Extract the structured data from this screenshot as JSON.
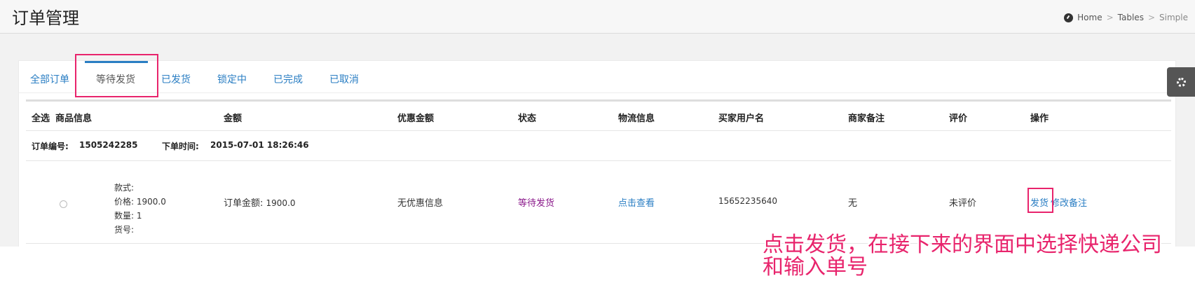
{
  "header": {
    "title": "订单管理"
  },
  "breadcrumb": {
    "items": [
      "Home",
      "Tables",
      "Simple"
    ],
    "separator": ">",
    "icon": "dashboard-icon"
  },
  "tabs": [
    {
      "label": "全部订单",
      "active": false
    },
    {
      "label": "等待发货",
      "active": true
    },
    {
      "label": "已发货",
      "active": false
    },
    {
      "label": "锁定中",
      "active": false
    },
    {
      "label": "已完成",
      "active": false
    },
    {
      "label": "已取消",
      "active": false
    }
  ],
  "table": {
    "headers": [
      "全选",
      "商品信息",
      "金额",
      "优惠金额",
      "状态",
      "物流信息",
      "买家用户名",
      "商家备注",
      "评价",
      "操作"
    ],
    "order": {
      "number_label": "订单编号:",
      "number": "1505242285",
      "time_label": "下单时间:",
      "time": "2015-07-01 18:26:46"
    },
    "row": {
      "style_label": "款式:",
      "style_value": "",
      "price_label": "价格:",
      "price": "1900.0",
      "qty_label": "数量:",
      "qty": "1",
      "sku_label": "货号:",
      "sku_value": "",
      "amount_label": "订单金额:",
      "amount": "1900.0",
      "discount": "无优惠信息",
      "status": "等待发货",
      "logistics": "点击查看",
      "buyer": "15652235640",
      "note": "无",
      "rating": "未评价",
      "action_ship": "发货",
      "action_note": "修改备注"
    }
  },
  "annotation": {
    "line1": "点击发货，在接下来的界面中选择快递公司",
    "line2": "和输入单号"
  },
  "colors": {
    "link": "#2a7ec3",
    "status": "#8b1a8b",
    "highlight": "#e8246c",
    "tab_indicator": "#2a7ec3"
  },
  "settings_icon": "gear-icon"
}
